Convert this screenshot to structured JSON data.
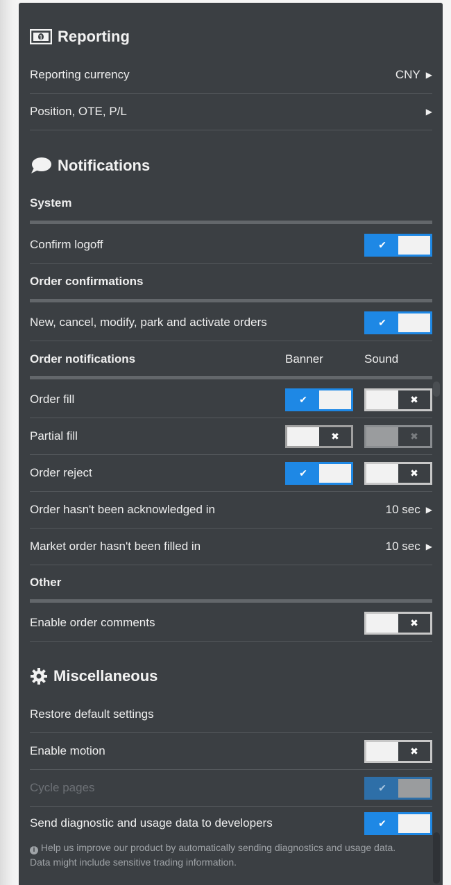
{
  "reporting": {
    "title": "Reporting",
    "icon": "money-icon",
    "currency_label": "Reporting currency",
    "currency_value": "CNY",
    "position_label": "Position, OTE, P/L"
  },
  "notifications": {
    "title": "Notifications",
    "icon": "speech-bubble-icon",
    "system_header": "System",
    "confirm_logoff_label": "Confirm logoff",
    "confirm_logoff_on": true,
    "order_conf_header": "Order confirmations",
    "order_conf_label": "New, cancel, modify, park and activate orders",
    "order_conf_on": true,
    "order_notif_header": "Order notifications",
    "col_banner": "Banner",
    "col_sound": "Sound",
    "rows": [
      {
        "label": "Order fill",
        "banner": true,
        "sound": false
      },
      {
        "label": "Partial fill",
        "banner": false,
        "sound": false
      },
      {
        "label": "Order reject",
        "banner": true,
        "sound": false
      }
    ],
    "ack_label": "Order hasn't been acknowledged in",
    "ack_value": "10 sec",
    "market_label": "Market order hasn't been filled in",
    "market_value": "10 sec",
    "other_header": "Other",
    "comments_label": "Enable order comments",
    "comments_on": false
  },
  "misc": {
    "title": "Miscellaneous",
    "icon": "gear-icon",
    "restore_label": "Restore default settings",
    "motion_label": "Enable motion",
    "motion_on": false,
    "cycle_label": "Cycle pages",
    "cycle_on": true,
    "diag_label": "Send diagnostic and usage data to developers",
    "diag_on": true,
    "help_text": "Help us improve our product by automatically sending diagnostics and usage data. Data might include sensitive trading information."
  },
  "colors": {
    "panel": "#3b3f43",
    "accent": "#1e88e5"
  }
}
